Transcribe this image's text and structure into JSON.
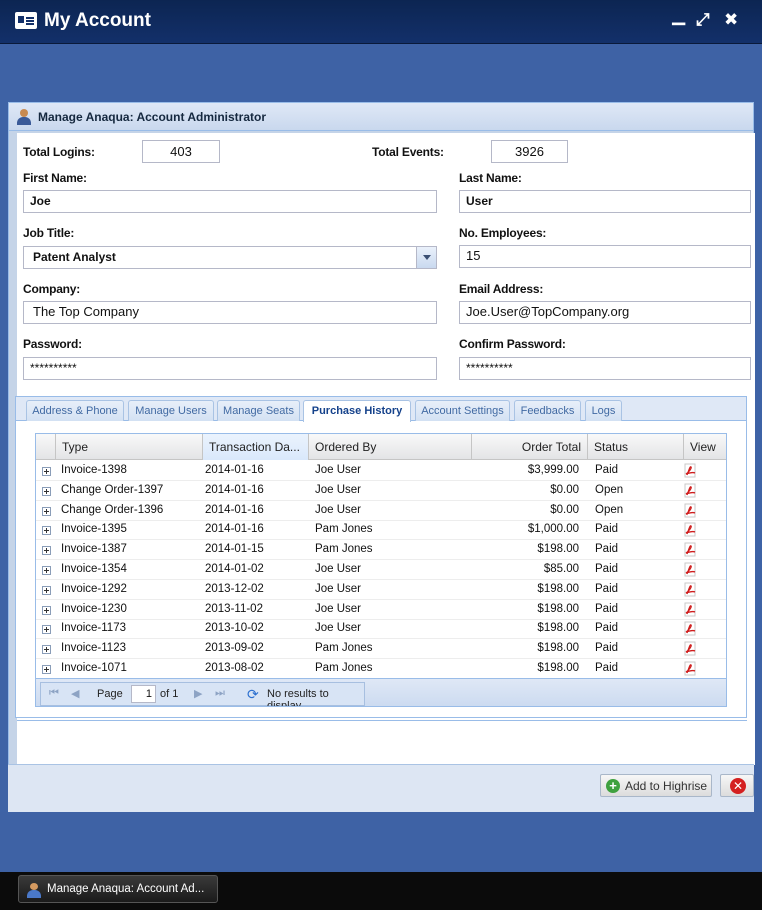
{
  "window": {
    "title": "My Account",
    "minimize_glyph": "▁",
    "maximize_glyph": "⤢",
    "close_glyph": "✖"
  },
  "dialog": {
    "title": "Manage Anaqua: Account Administrator"
  },
  "form": {
    "total_logins_label": "Total Logins:",
    "total_logins_value": "403",
    "total_events_label": "Total Events:",
    "total_events_value": "3926",
    "first_name_label": "First Name:",
    "first_name_value": "Joe",
    "last_name_label": "Last Name:",
    "last_name_value": "User",
    "job_title_label": "Job Title:",
    "job_title_value": "Patent Analyst",
    "employees_label": "No. Employees:",
    "employees_value": "15",
    "company_label": "Company:",
    "company_value": "The Top Company",
    "email_label": "Email Address:",
    "email_value": "Joe.User@TopCompany.org",
    "password_label": "Password:",
    "password_value": "**********",
    "confirm_password_label": "Confirm Password:",
    "confirm_password_value": "**********"
  },
  "tabs": [
    {
      "label": "Address & Phone"
    },
    {
      "label": "Manage Users"
    },
    {
      "label": "Manage Seats"
    },
    {
      "label": "Purchase History"
    },
    {
      "label": "Account Settings"
    },
    {
      "label": "Feedbacks"
    },
    {
      "label": "Logs"
    }
  ],
  "grid": {
    "columns": [
      "Type",
      "Transaction Da...",
      "Ordered By",
      "Order Total",
      "Status",
      "View"
    ],
    "rows": [
      {
        "type": "Invoice-1398",
        "date": "2014-01-16",
        "by": "Joe User",
        "total": "$3,999.00",
        "status": "Paid"
      },
      {
        "type": "Change Order-1397",
        "date": "2014-01-16",
        "by": "Joe User",
        "total": "$0.00",
        "status": "Open"
      },
      {
        "type": "Change Order-1396",
        "date": "2014-01-16",
        "by": "Joe User",
        "total": "$0.00",
        "status": "Open"
      },
      {
        "type": "Invoice-1395",
        "date": "2014-01-16",
        "by": "Pam Jones",
        "total": "$1,000.00",
        "status": "Paid"
      },
      {
        "type": "Invoice-1387",
        "date": "2014-01-15",
        "by": "Pam Jones",
        "total": "$198.00",
        "status": "Paid"
      },
      {
        "type": "Invoice-1354",
        "date": "2014-01-02",
        "by": "Joe User",
        "total": "$85.00",
        "status": "Paid"
      },
      {
        "type": "Invoice-1292",
        "date": "2013-12-02",
        "by": "Joe User",
        "total": "$198.00",
        "status": "Paid"
      },
      {
        "type": "Invoice-1230",
        "date": "2013-11-02",
        "by": "Joe User",
        "total": "$198.00",
        "status": "Paid"
      },
      {
        "type": "Invoice-1173",
        "date": "2013-10-02",
        "by": "Joe User",
        "total": "$198.00",
        "status": "Paid"
      },
      {
        "type": "Invoice-1123",
        "date": "2013-09-02",
        "by": "Pam Jones",
        "total": "$198.00",
        "status": "Paid"
      },
      {
        "type": "Invoice-1071",
        "date": "2013-08-02",
        "by": "Pam Jones",
        "total": "$198.00",
        "status": "Paid"
      }
    ]
  },
  "pager": {
    "page_label": "Page",
    "page_value": "1",
    "of_label": "of 1",
    "empty_msg": "No results to display"
  },
  "footer": {
    "add_highrise": "Add to Highrise"
  },
  "taskbar": {
    "item_label": "Manage Anaqua: Account Ad..."
  }
}
